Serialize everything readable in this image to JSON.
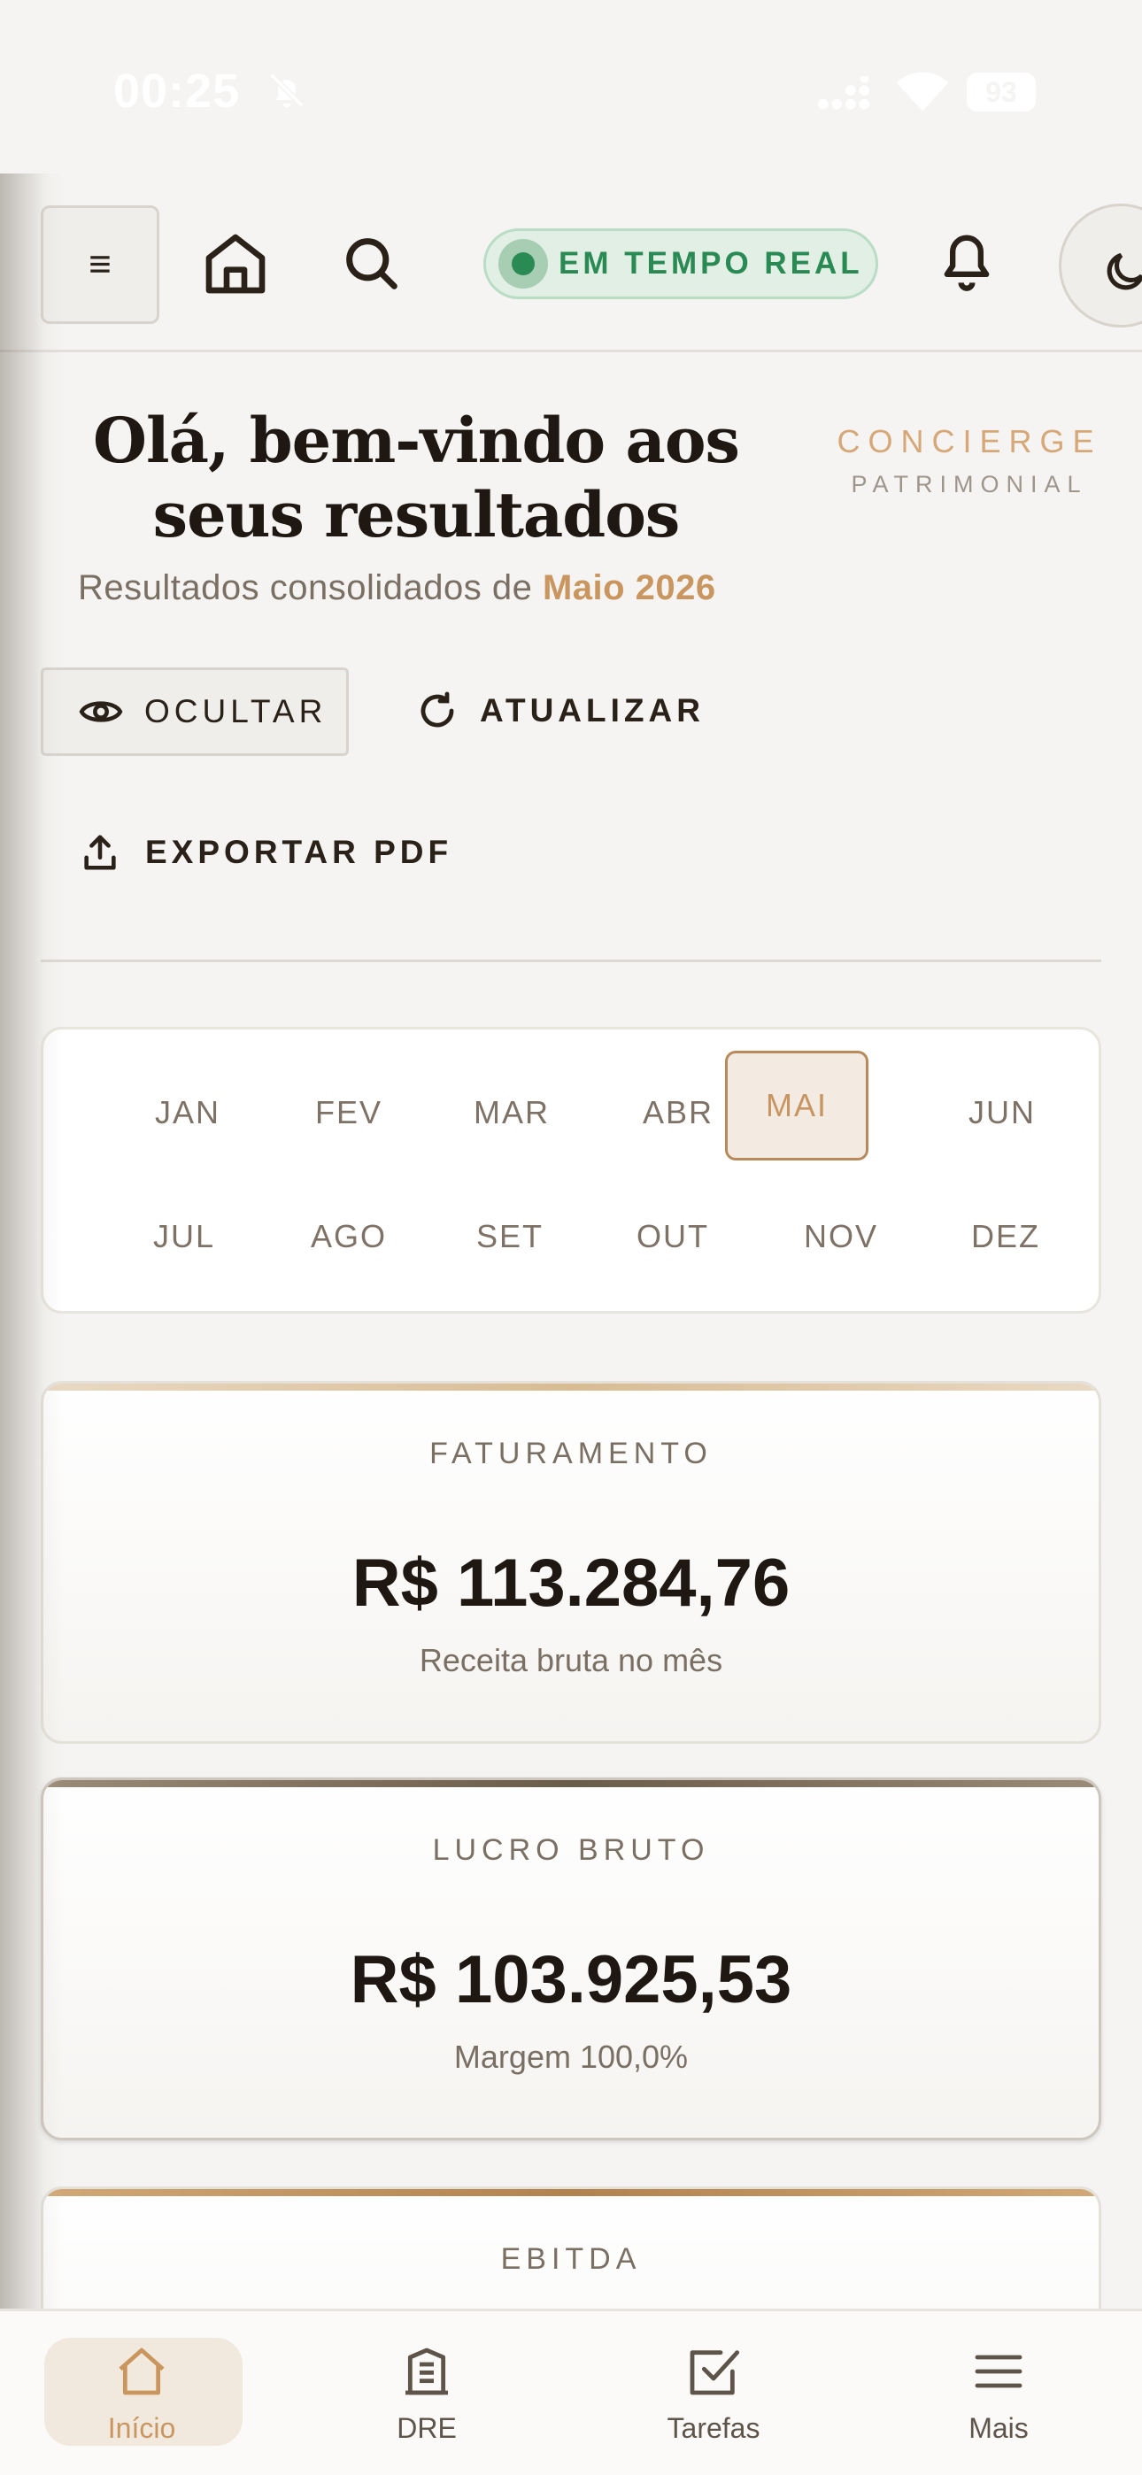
{
  "status_bar": {
    "time": "00:25",
    "battery": "93"
  },
  "toolbar": {
    "menu_icon": "≡",
    "live_label": "EM TEMPO REAL"
  },
  "header": {
    "greeting": "Olá, bem-vindo aos seus resultados",
    "brand_line1": "CONCIERGE",
    "brand_line2": "PATRIMONIAL",
    "subtitle_prefix": "Resultados consolidados de ",
    "subtitle_period": "Maio 2026"
  },
  "actions": {
    "hide": "OCULTAR",
    "refresh": "ATUALIZAR",
    "export": "EXPORTAR PDF"
  },
  "months": [
    "JAN",
    "FEV",
    "MAR",
    "ABR",
    "MAI",
    "JUN",
    "JUL",
    "AGO",
    "SET",
    "OUT",
    "NOV",
    "DEZ"
  ],
  "selected_month": "MAI",
  "kpis": [
    {
      "label": "FATURAMENTO",
      "value": "R$ 113.284,76",
      "sub": "Receita bruta no mês"
    },
    {
      "label": "LUCRO BRUTO",
      "value": "R$ 103.925,53",
      "sub": "Margem 100,0%"
    },
    {
      "label": "EBITDA",
      "value": "",
      "sub": ""
    }
  ],
  "bottom_nav": [
    {
      "label": "Início",
      "icon": "home-icon",
      "active": true
    },
    {
      "label": "DRE",
      "icon": "building-icon",
      "active": false
    },
    {
      "label": "Tarefas",
      "icon": "checkbox-icon",
      "active": false
    },
    {
      "label": "Mais",
      "icon": "menu-icon",
      "active": false
    }
  ],
  "colors": {
    "accent": "#c9965f",
    "live_green": "#2a8a54",
    "background": "#f5f4f2"
  }
}
